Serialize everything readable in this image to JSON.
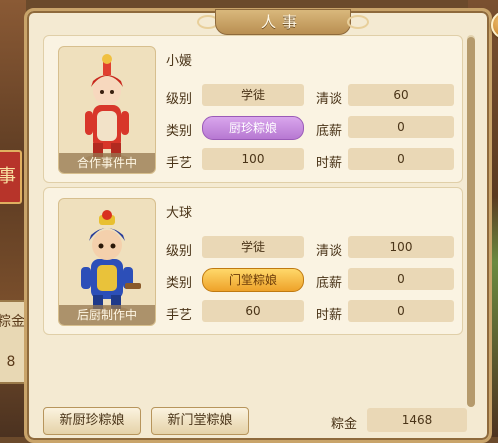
{
  "window": {
    "title": "人事"
  },
  "background": {
    "left_sign_1": "事",
    "left_sign_2": "粽金",
    "left_value": "8"
  },
  "employees": [
    {
      "name": "小媛",
      "status": "合作事件中",
      "level_label": "级别",
      "level": "学徒",
      "type_label": "类别",
      "type": "厨珍粽娘",
      "skill_label": "手艺",
      "skill": "100",
      "talk_label": "清谈",
      "talk": "60",
      "salary_label": "底薪",
      "salary": "0",
      "hourly_label": "时薪",
      "hourly": "0"
    },
    {
      "name": "大球",
      "status": "后厨制作中",
      "level_label": "级别",
      "level": "学徒",
      "type_label": "类别",
      "type": "门堂粽娘",
      "skill_label": "手艺",
      "skill": "60",
      "talk_label": "清谈",
      "talk": "100",
      "salary_label": "底薪",
      "salary": "0",
      "hourly_label": "时薪",
      "hourly": "0"
    }
  ],
  "footer": {
    "new_kitchen_button": "新厨珍粽娘",
    "new_hall_button": "新门堂粽娘",
    "money_label": "粽金",
    "money": "1468"
  },
  "colors": {
    "panel": "#f4ead2",
    "border": "#c9a46a",
    "tag_purple": "#c08ade",
    "tag_gold": "#f4b840"
  }
}
